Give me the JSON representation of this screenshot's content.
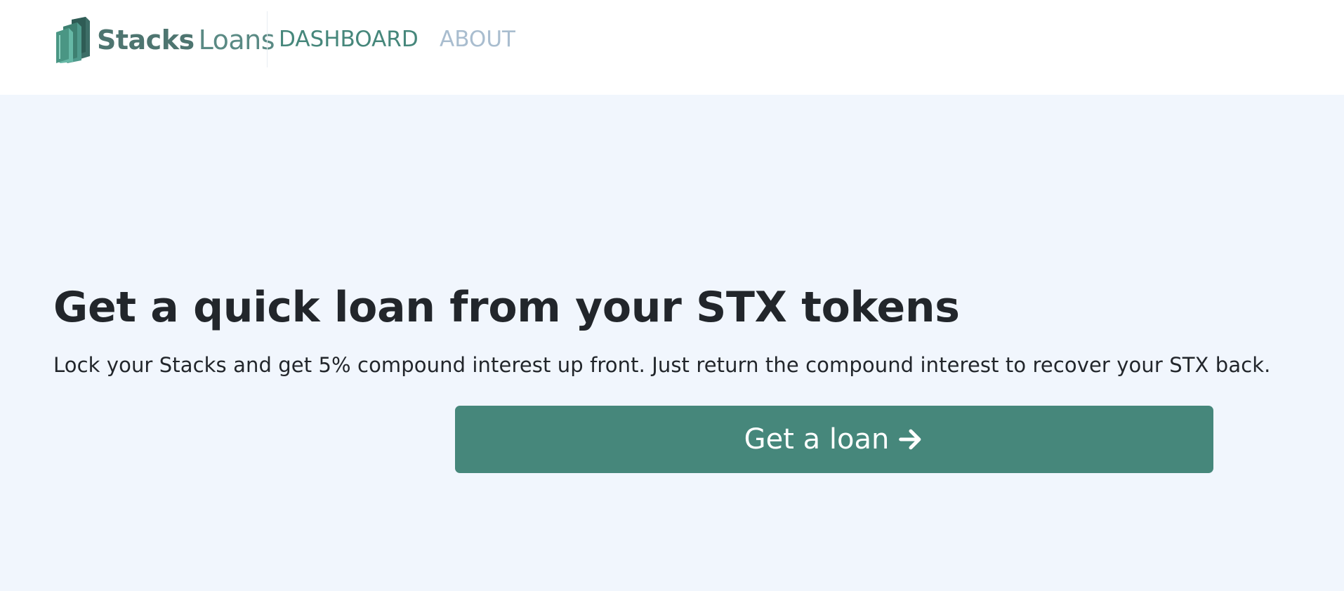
{
  "brand": {
    "name_strong": "Stacks",
    "name_light": "Loans",
    "logo_icon": "stacked-books-logo-icon",
    "color": "#4e7570"
  },
  "nav": {
    "items": [
      {
        "label": "DASHBOARD",
        "active": true
      },
      {
        "label": "ABOUT",
        "active": false
      }
    ],
    "active_color": "#46877b",
    "inactive_color": "#a9bdcf"
  },
  "hero": {
    "title": "Get a quick loan from your STX tokens",
    "subtitle": "Lock your Stacks and get 5% compound interest up front. Just return the compound interest to recover your STX back.",
    "background": "#f1f6fd"
  },
  "cta": {
    "label": "Get a loan",
    "icon": "arrow-right-icon",
    "color": "#46877b"
  }
}
